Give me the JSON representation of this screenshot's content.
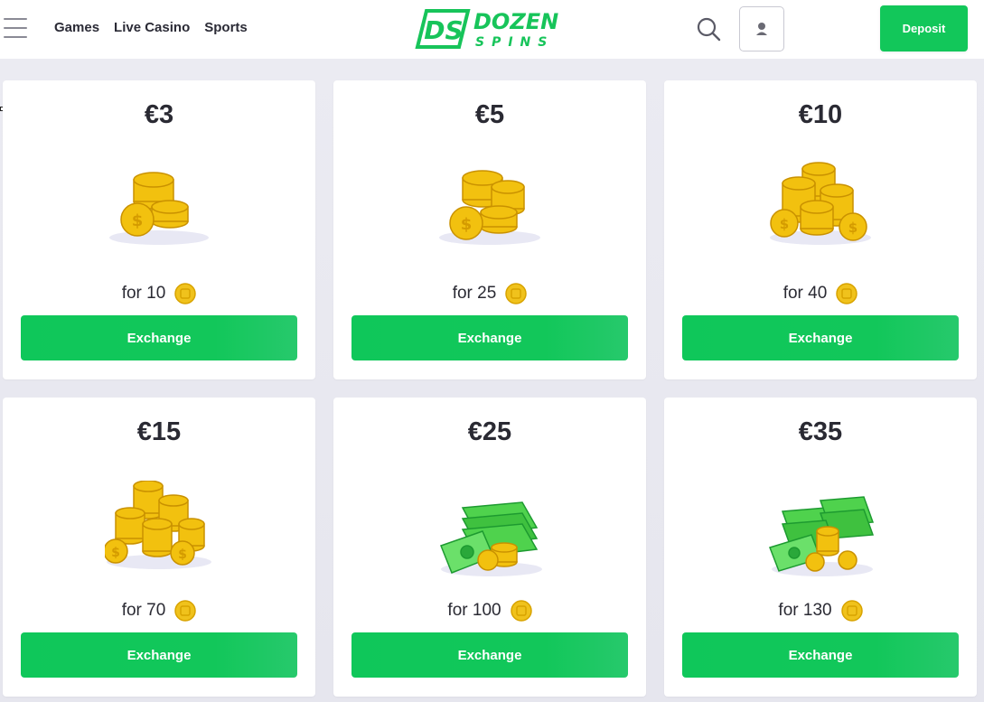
{
  "header": {
    "nav": [
      "Games",
      "Live Casino",
      "Sports"
    ],
    "logo_initials": "DS",
    "logo_line1": "DOZEN",
    "logo_line2": "SPINS",
    "deposit_label": "Deposit"
  },
  "colors": {
    "brand_green": "#12c75a",
    "text_dark": "#2a2a33",
    "background": "#e9e9f0"
  },
  "offers": [
    {
      "price": "€3",
      "cost": "for 10",
      "art": "coin-stack-small-icon",
      "button": "Exchange"
    },
    {
      "price": "€5",
      "cost": "for 25",
      "art": "coin-stack-medium-icon",
      "button": "Exchange"
    },
    {
      "price": "€10",
      "cost": "for 40",
      "art": "coin-stack-large-icon",
      "button": "Exchange"
    },
    {
      "price": "€15",
      "cost": "for 70",
      "art": "coin-pile-icon",
      "button": "Exchange"
    },
    {
      "price": "€25",
      "cost": "for 100",
      "art": "cash-stack-icon",
      "button": "Exchange"
    },
    {
      "price": "€35",
      "cost": "for 130",
      "art": "cash-bundle-icon",
      "button": "Exchange"
    }
  ]
}
